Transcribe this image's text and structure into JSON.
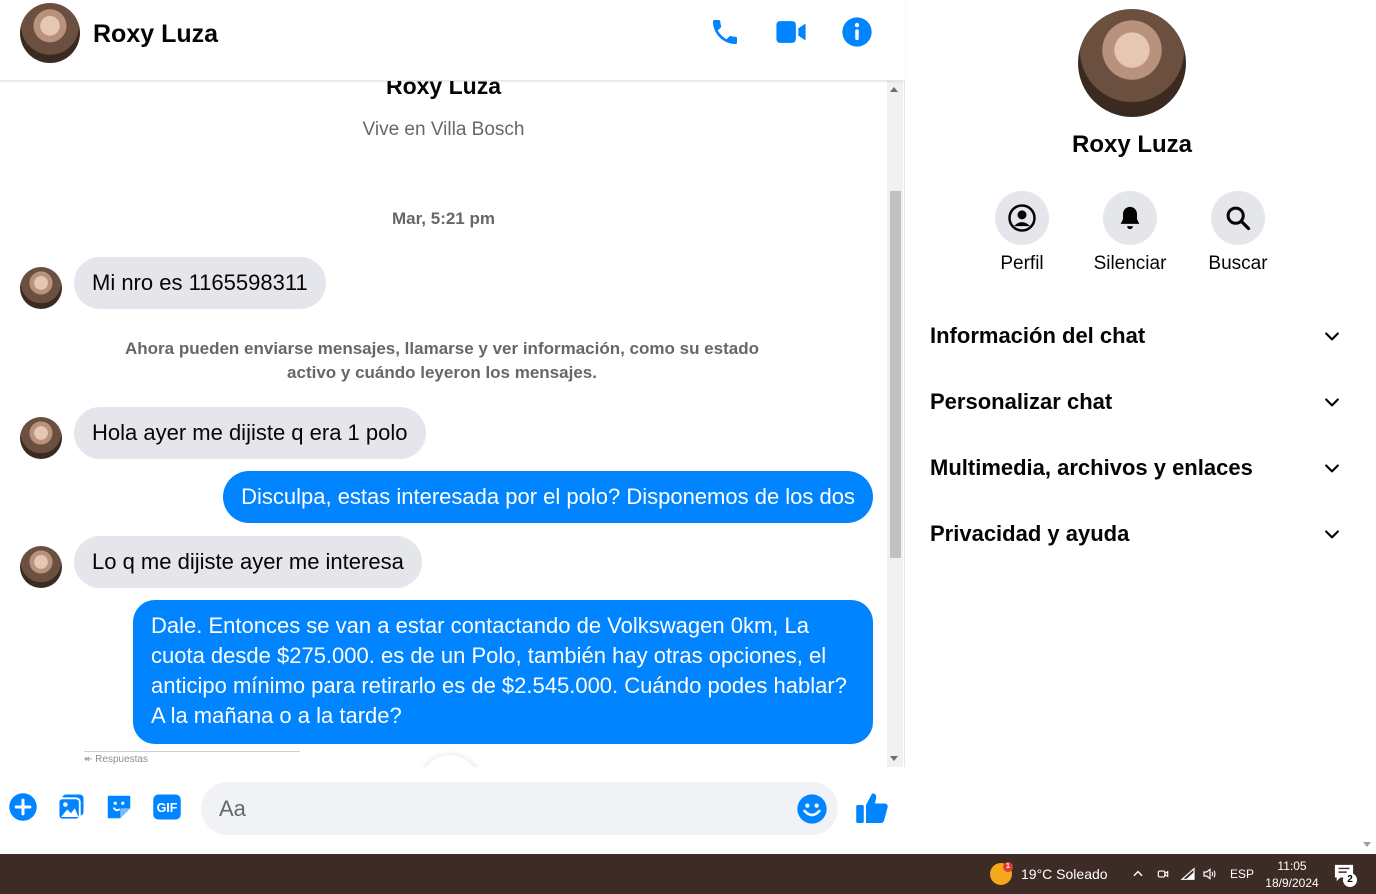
{
  "contact": {
    "name": "Roxy Luza",
    "location": "Vive en Villa Bosch"
  },
  "header": {
    "name": "Roxy Luza"
  },
  "conversation": {
    "timestamp": "Mar, 5:21 pm",
    "system_notice": "Ahora pueden enviarse mensajes, llamarse y ver información, como su estado activo y cuándo leyeron los mensajes.",
    "messages": [
      {
        "sender": "them",
        "text": "Mi nro es 1165598311"
      },
      {
        "sender": "them",
        "text": "Hola ayer me dijiste q era 1 polo"
      },
      {
        "sender": "me",
        "text": "Disculpa, estas interesada por el polo? Disponemos de los dos"
      },
      {
        "sender": "them",
        "text": "Lo q me dijiste ayer me interesa"
      },
      {
        "sender": "me",
        "text": "Dale. Entonces se van a estar contactando de Volkswagen 0km, La cuota desde $275.000. es de un Polo, también hay otras opciones, el anticipo mínimo para retirarlo es de $2.545.000. Cuándo podes hablar? A la mañana o a la tarde?"
      }
    ],
    "reply_hint": "Respuestas"
  },
  "composer": {
    "placeholder": "Aa",
    "gif_label": "GIF"
  },
  "panel": {
    "name": "Roxy Luza",
    "actions": [
      {
        "label": "Perfil",
        "icon": "profile-icon"
      },
      {
        "label": "Silenciar",
        "icon": "bell-icon"
      },
      {
        "label": "Buscar",
        "icon": "search-icon"
      }
    ],
    "sections": [
      "Información del chat",
      "Personalizar chat",
      "Multimedia, archivos y enlaces",
      "Privacidad y ayuda"
    ]
  },
  "taskbar": {
    "weather": "19°C  Soleado",
    "weather_badge": "1",
    "language": "ESP",
    "time": "11:05",
    "date": "18/9/2024",
    "notifications": "2"
  },
  "colors": {
    "accent": "#0084ff",
    "incoming_bubble": "#e4e6eb",
    "taskbar": "#3d2b26"
  }
}
